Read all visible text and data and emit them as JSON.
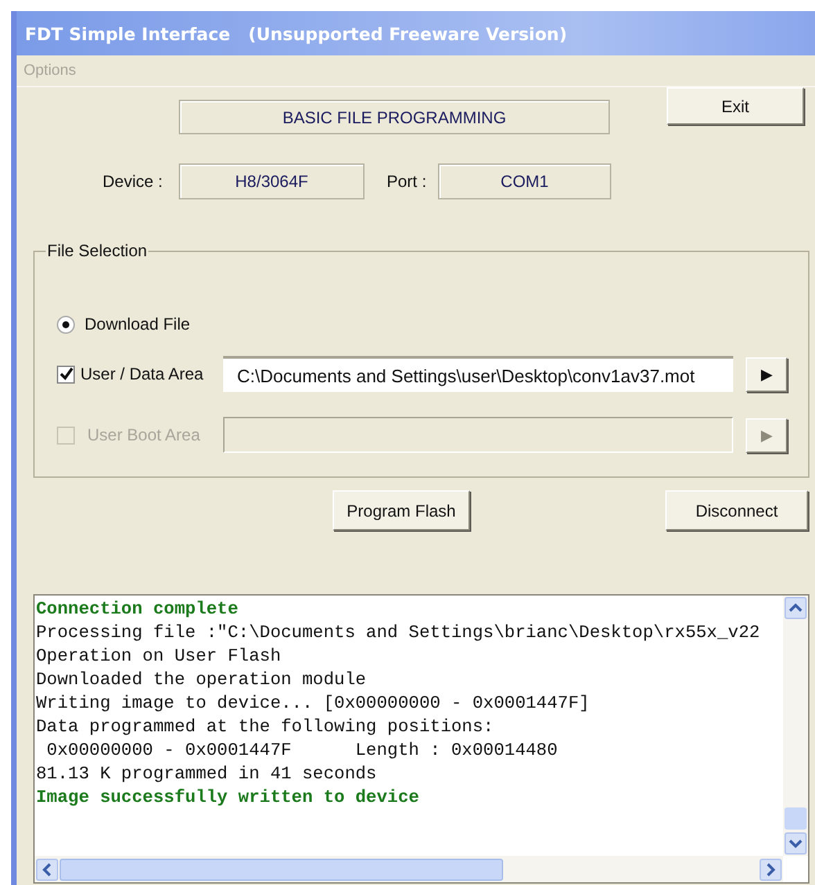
{
  "window": {
    "title": "FDT Simple Interface   (Unsupported Freeware Version)"
  },
  "menu": [
    {
      "label": "Options",
      "disabled": true
    }
  ],
  "mode_display": "BASIC FILE PROGRAMMING",
  "exit_button": "Exit",
  "device": {
    "label": "Device :",
    "value": "H8/3064F"
  },
  "port": {
    "label": "Port :",
    "value": "COM1"
  },
  "file_selection": {
    "title": "File Selection",
    "radio": {
      "label": "Download File",
      "selected": true
    },
    "areas": [
      {
        "label": "User / Data Area",
        "checked": true,
        "disabled": false,
        "path": "C:\\Documents and Settings\\user\\Desktop\\conv1av37.mot",
        "browse": "▶"
      },
      {
        "label": "User Boot Area",
        "checked": false,
        "disabled": true,
        "browse": "▶"
      }
    ]
  },
  "buttons": [
    {
      "label": "Program Flash"
    },
    {
      "label": "Disconnect"
    }
  ],
  "log": [
    {
      "kind": "success",
      "text": "Connection complete"
    },
    {
      "kind": "plain",
      "text": "Processing file :\"C:\\Documents and Settings\\brianc\\Desktop\\rx55x_v22"
    },
    {
      "kind": "plain",
      "text": "Operation on User Flash"
    },
    {
      "kind": "plain",
      "text": "Downloaded the operation module"
    },
    {
      "kind": "plain",
      "text": "Writing image to device... [0x00000000 - 0x0001447F]"
    },
    {
      "kind": "plain",
      "text": "Data programmed at the following positions:"
    },
    {
      "kind": "plain",
      "text": " 0x00000000 - 0x0001447F      Length : 0x00014480"
    },
    {
      "kind": "plain",
      "text": "81.13 K programmed in 41 seconds"
    },
    {
      "kind": "success",
      "text": "Image successfully written to device"
    }
  ]
}
